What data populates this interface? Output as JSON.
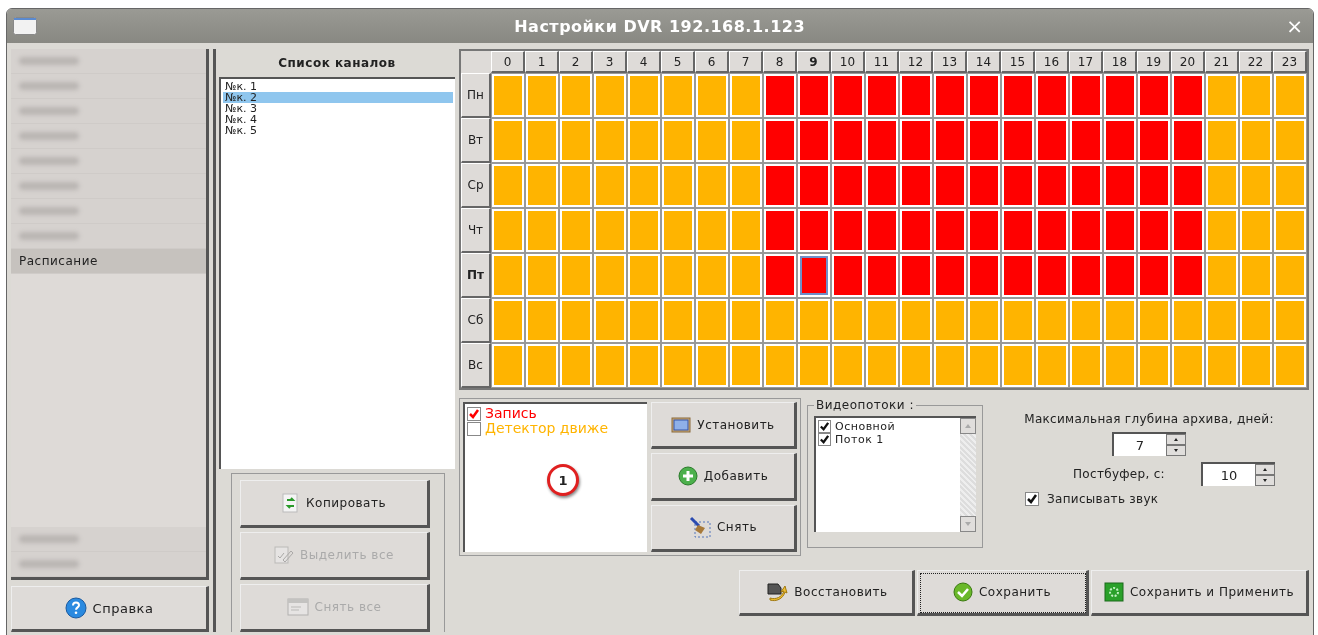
{
  "window": {
    "title": "Настройки DVR 192.168.1.123",
    "close": "×"
  },
  "sidebar": {
    "items": [
      {
        "kind": "blurred",
        "selected": false
      },
      {
        "kind": "blurred",
        "selected": false
      },
      {
        "kind": "blurred",
        "selected": false
      },
      {
        "kind": "blurred",
        "selected": false
      },
      {
        "kind": "blurred",
        "selected": false
      },
      {
        "kind": "blurred",
        "selected": false
      },
      {
        "kind": "blurred",
        "selected": false
      },
      {
        "kind": "blurred",
        "selected": false
      },
      {
        "kind": "item",
        "label": "Расписание",
        "selected": true
      }
    ],
    "bottom_items": [
      {
        "kind": "blurred",
        "selected": false
      },
      {
        "kind": "blurred",
        "selected": false
      }
    ],
    "help_button": "Справка"
  },
  "channels": {
    "title": "Список каналов",
    "items": [
      {
        "label": "№к. 1",
        "selected": false
      },
      {
        "label": "№к. 2",
        "selected": true
      },
      {
        "label": "№к. 3",
        "selected": false
      },
      {
        "label": "№к. 4",
        "selected": false
      },
      {
        "label": "№к. 5",
        "selected": false
      }
    ],
    "buttons": [
      {
        "label": "Копировать",
        "kind": "copy",
        "disabled": false
      },
      {
        "label": "Выделить все",
        "kind": "select",
        "disabled": true
      },
      {
        "label": "Снять все",
        "kind": "clear",
        "disabled": true
      }
    ]
  },
  "schedule": {
    "hours": [
      {
        "label": "0",
        "selected": false
      },
      {
        "label": "1",
        "selected": false
      },
      {
        "label": "2",
        "selected": false
      },
      {
        "label": "3",
        "selected": false
      },
      {
        "label": "4",
        "selected": false
      },
      {
        "label": "5",
        "selected": false
      },
      {
        "label": "6",
        "selected": false
      },
      {
        "label": "7",
        "selected": false
      },
      {
        "label": "8",
        "selected": false
      },
      {
        "label": "9",
        "selected": true
      },
      {
        "label": "10",
        "selected": false
      },
      {
        "label": "11",
        "selected": false
      },
      {
        "label": "12",
        "selected": false
      },
      {
        "label": "13",
        "selected": false
      },
      {
        "label": "14",
        "selected": false
      },
      {
        "label": "15",
        "selected": false
      },
      {
        "label": "16",
        "selected": false
      },
      {
        "label": "17",
        "selected": false
      },
      {
        "label": "18",
        "selected": false
      },
      {
        "label": "19",
        "selected": false
      },
      {
        "label": "20",
        "selected": false
      },
      {
        "label": "21",
        "selected": false
      },
      {
        "label": "22",
        "selected": false
      },
      {
        "label": "23",
        "selected": false
      }
    ],
    "days": [
      {
        "label": "Пн",
        "selected": false,
        "cells": [
          {
            "kind": "mot"
          },
          {
            "kind": "mot"
          },
          {
            "kind": "mot"
          },
          {
            "kind": "mot"
          },
          {
            "kind": "mot"
          },
          {
            "kind": "mot"
          },
          {
            "kind": "mot"
          },
          {
            "kind": "mot"
          },
          {
            "kind": "rec"
          },
          {
            "kind": "rec"
          },
          {
            "kind": "rec"
          },
          {
            "kind": "rec"
          },
          {
            "kind": "rec"
          },
          {
            "kind": "rec"
          },
          {
            "kind": "rec"
          },
          {
            "kind": "rec"
          },
          {
            "kind": "rec"
          },
          {
            "kind": "rec"
          },
          {
            "kind": "rec"
          },
          {
            "kind": "rec"
          },
          {
            "kind": "rec"
          },
          {
            "kind": "mot"
          },
          {
            "kind": "mot"
          },
          {
            "kind": "mot"
          }
        ]
      },
      {
        "label": "Вт",
        "selected": false,
        "cells": [
          {
            "kind": "mot"
          },
          {
            "kind": "mot"
          },
          {
            "kind": "mot"
          },
          {
            "kind": "mot"
          },
          {
            "kind": "mot"
          },
          {
            "kind": "mot"
          },
          {
            "kind": "mot"
          },
          {
            "kind": "mot"
          },
          {
            "kind": "rec"
          },
          {
            "kind": "rec"
          },
          {
            "kind": "rec"
          },
          {
            "kind": "rec"
          },
          {
            "kind": "rec"
          },
          {
            "kind": "rec"
          },
          {
            "kind": "rec"
          },
          {
            "kind": "rec"
          },
          {
            "kind": "rec"
          },
          {
            "kind": "rec"
          },
          {
            "kind": "rec"
          },
          {
            "kind": "rec"
          },
          {
            "kind": "rec"
          },
          {
            "kind": "mot"
          },
          {
            "kind": "mot"
          },
          {
            "kind": "mot"
          }
        ]
      },
      {
        "label": "Ср",
        "selected": false,
        "cells": [
          {
            "kind": "mot"
          },
          {
            "kind": "mot"
          },
          {
            "kind": "mot"
          },
          {
            "kind": "mot"
          },
          {
            "kind": "mot"
          },
          {
            "kind": "mot"
          },
          {
            "kind": "mot"
          },
          {
            "kind": "mot"
          },
          {
            "kind": "rec"
          },
          {
            "kind": "rec"
          },
          {
            "kind": "rec"
          },
          {
            "kind": "rec"
          },
          {
            "kind": "rec"
          },
          {
            "kind": "rec"
          },
          {
            "kind": "rec"
          },
          {
            "kind": "rec"
          },
          {
            "kind": "rec"
          },
          {
            "kind": "rec"
          },
          {
            "kind": "rec"
          },
          {
            "kind": "rec"
          },
          {
            "kind": "rec"
          },
          {
            "kind": "mot"
          },
          {
            "kind": "mot"
          },
          {
            "kind": "mot"
          }
        ]
      },
      {
        "label": "Чт",
        "selected": false,
        "cells": [
          {
            "kind": "mot"
          },
          {
            "kind": "mot"
          },
          {
            "kind": "mot"
          },
          {
            "kind": "mot"
          },
          {
            "kind": "mot"
          },
          {
            "kind": "mot"
          },
          {
            "kind": "mot"
          },
          {
            "kind": "mot"
          },
          {
            "kind": "rec"
          },
          {
            "kind": "rec"
          },
          {
            "kind": "rec"
          },
          {
            "kind": "rec"
          },
          {
            "kind": "rec"
          },
          {
            "kind": "rec"
          },
          {
            "kind": "rec"
          },
          {
            "kind": "rec"
          },
          {
            "kind": "rec"
          },
          {
            "kind": "rec"
          },
          {
            "kind": "rec"
          },
          {
            "kind": "rec"
          },
          {
            "kind": "rec"
          },
          {
            "kind": "mot"
          },
          {
            "kind": "mot"
          },
          {
            "kind": "mot"
          }
        ]
      },
      {
        "label": "Пт",
        "selected": true,
        "cells": [
          {
            "kind": "mot"
          },
          {
            "kind": "mot"
          },
          {
            "kind": "mot"
          },
          {
            "kind": "mot"
          },
          {
            "kind": "mot"
          },
          {
            "kind": "mot"
          },
          {
            "kind": "mot"
          },
          {
            "kind": "mot"
          },
          {
            "kind": "rec"
          },
          {
            "kind": "rec"
          },
          {
            "kind": "rec"
          },
          {
            "kind": "rec"
          },
          {
            "kind": "rec"
          },
          {
            "kind": "rec"
          },
          {
            "kind": "rec"
          },
          {
            "kind": "rec"
          },
          {
            "kind": "rec"
          },
          {
            "kind": "rec"
          },
          {
            "kind": "rec"
          },
          {
            "kind": "rec"
          },
          {
            "kind": "rec"
          },
          {
            "kind": "mot"
          },
          {
            "kind": "mot"
          },
          {
            "kind": "mot"
          }
        ]
      },
      {
        "label": "Сб",
        "selected": false,
        "cells": [
          {
            "kind": "mot"
          },
          {
            "kind": "mot"
          },
          {
            "kind": "mot"
          },
          {
            "kind": "mot"
          },
          {
            "kind": "mot"
          },
          {
            "kind": "mot"
          },
          {
            "kind": "mot"
          },
          {
            "kind": "mot"
          },
          {
            "kind": "mot"
          },
          {
            "kind": "mot"
          },
          {
            "kind": "mot"
          },
          {
            "kind": "mot"
          },
          {
            "kind": "mot"
          },
          {
            "kind": "mot"
          },
          {
            "kind": "mot"
          },
          {
            "kind": "mot"
          },
          {
            "kind": "mot"
          },
          {
            "kind": "mot"
          },
          {
            "kind": "mot"
          },
          {
            "kind": "mot"
          },
          {
            "kind": "mot"
          },
          {
            "kind": "mot"
          },
          {
            "kind": "mot"
          },
          {
            "kind": "mot"
          }
        ]
      },
      {
        "label": "Вс",
        "selected": false,
        "cells": [
          {
            "kind": "mot"
          },
          {
            "kind": "mot"
          },
          {
            "kind": "mot"
          },
          {
            "kind": "mot"
          },
          {
            "kind": "mot"
          },
          {
            "kind": "mot"
          },
          {
            "kind": "mot"
          },
          {
            "kind": "mot"
          },
          {
            "kind": "mot"
          },
          {
            "kind": "mot"
          },
          {
            "kind": "mot"
          },
          {
            "kind": "mot"
          },
          {
            "kind": "mot"
          },
          {
            "kind": "mot"
          },
          {
            "kind": "mot"
          },
          {
            "kind": "mot"
          },
          {
            "kind": "mot"
          },
          {
            "kind": "mot"
          },
          {
            "kind": "mot"
          },
          {
            "kind": "mot"
          },
          {
            "kind": "mot"
          },
          {
            "kind": "mot"
          },
          {
            "kind": "mot"
          },
          {
            "kind": "mot"
          }
        ]
      }
    ]
  },
  "modes": {
    "items": [
      {
        "kind": "rec",
        "label": "Запись",
        "checked": true,
        "color": "#ff0000"
      },
      {
        "kind": "mot",
        "label": "Детектор движе",
        "checked": false,
        "color": "#ffb400"
      }
    ],
    "marker": "1",
    "buttons": [
      {
        "label": "Установить",
        "kind": "set"
      },
      {
        "label": "Добавить",
        "kind": "add"
      },
      {
        "label": "Снять",
        "kind": "remove"
      }
    ]
  },
  "streams": {
    "title": "Видеопотоки :",
    "items": [
      {
        "label": "Основной",
        "checked": true
      },
      {
        "label": "Поток 1",
        "checked": true
      }
    ]
  },
  "archive": {
    "depth_label": "Максимальная глубина архива, дней:",
    "depth_value": "7",
    "postbuffer_label": "Постбуфер, с:",
    "postbuffer_value": "10",
    "sound_label": "Записывать звук",
    "sound_checked": true
  },
  "actions": [
    {
      "label": "Восстановить",
      "kind": "restore",
      "focused": false
    },
    {
      "label": "Сохранить",
      "kind": "save",
      "focused": true
    },
    {
      "label": "Сохранить и Применить",
      "kind": "apply",
      "focused": false
    }
  ]
}
